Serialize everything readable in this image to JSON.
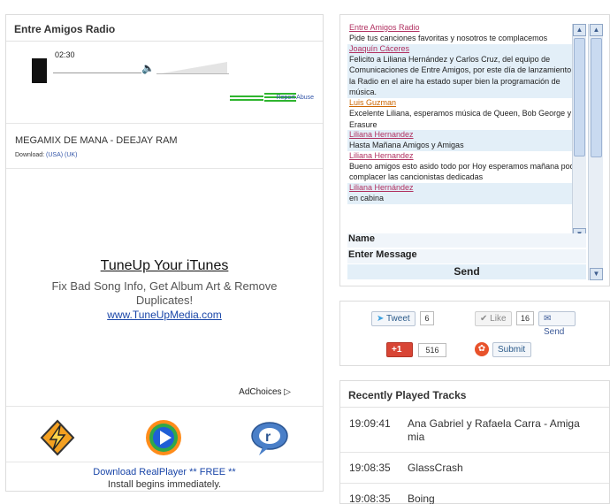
{
  "left": {
    "title": "Entre Amigos Radio",
    "player": {
      "time": "02:30",
      "report_label": "Report Abuse",
      "volume_level": 0.95
    },
    "now_playing": {
      "song": "MEGAMIX DE MANA - DEEJAY RAM",
      "download_label": "Download:",
      "usa": "(USA)",
      "uk": "(UK)"
    },
    "ad": {
      "title": "TuneUp Your iTunes",
      "description": "Fix Bad Song Info, Get Album Art & Remove Duplicates!",
      "url": "www.TuneUpMedia.com",
      "adchoices": "AdChoices"
    },
    "players": [
      {
        "name": "winamp-icon"
      },
      {
        "name": "windows-media-player-icon"
      },
      {
        "name": "realplayer-icon"
      }
    ],
    "realplayer": {
      "line1": "Download RealPlayer ** FREE **",
      "line2": "Install begins immediately."
    }
  },
  "chat": {
    "messages": [
      {
        "user": "Entre Amigos Radio",
        "text": "Pide tus canciones favoritas y nosotros te complacemos",
        "alt": false,
        "color": "#b03060"
      },
      {
        "user": "Joaquín Cáceres",
        "text": "Felicito a Liliana Hernández y Carlos Cruz, del equipo de Comunicaciones de Entre Amigos, por este día de lanzamiento de la Radio en el aire ha estado super bien la programación de música.",
        "alt": true,
        "color": "#b03060"
      },
      {
        "user": "Luis Guzman",
        "text": "Excelente Liliana, esperamos música de Queen, Bob George y Erasure",
        "alt": false,
        "color": "#cc6600"
      },
      {
        "user": "Liliana Hernandez",
        "text": "Hasta Mañana Amigos y Amigas",
        "alt": true,
        "color": "#b03060"
      },
      {
        "user": "Liliana Hernandez",
        "text": "Bueno amigos esto asido todo por Hoy esperamos mañana poder complacer las cancionistas dedicadas",
        "alt": false,
        "color": "#b03060"
      },
      {
        "user": "Liliana Hernández",
        "text": "en cabina",
        "alt": true,
        "color": "#b03060"
      }
    ],
    "name_label": "Name",
    "message_label": "Enter Message",
    "send_label": "Send"
  },
  "social": {
    "tweet_label": "Tweet",
    "tweet_count": "6",
    "like_label": "Like",
    "like_count": "16",
    "send_label": "Send",
    "gplus_label": "+1",
    "gplus_count": "516",
    "submit_label": "Submit"
  },
  "recent": {
    "title": "Recently Played Tracks",
    "tracks": [
      {
        "time": "19:09:41",
        "name": "Ana Gabriel y Rafaela Carra - Amiga mia"
      },
      {
        "time": "19:08:35",
        "name": "GlassCrash"
      },
      {
        "time": "19:08:35",
        "name": "Boing"
      }
    ]
  }
}
